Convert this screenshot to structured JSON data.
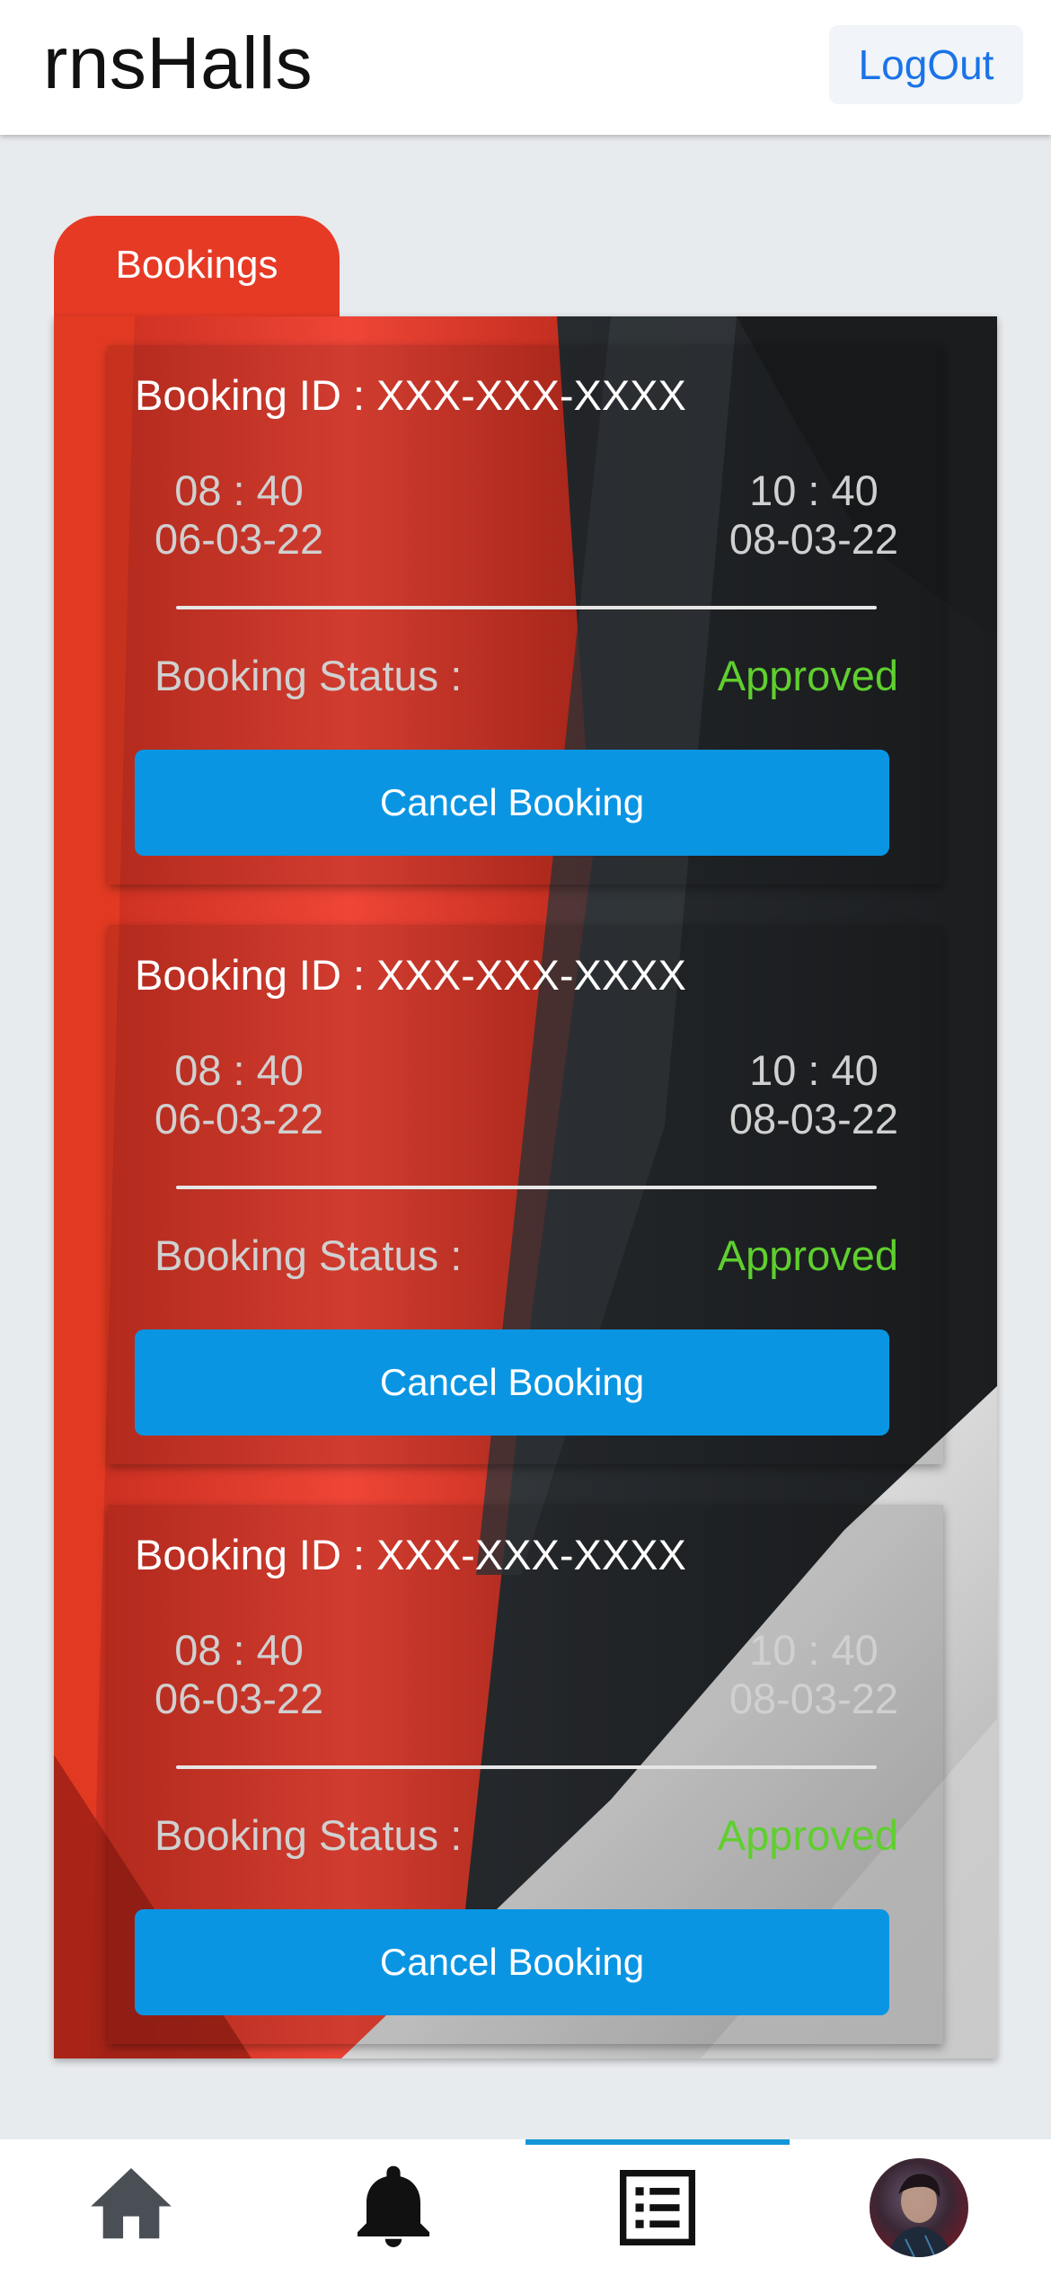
{
  "header": {
    "title": "rnsHalls",
    "logout_label": "LogOut"
  },
  "tab": {
    "label": "Bookings"
  },
  "bookings": [
    {
      "id_text": "Booking ID : XXX-XXX-XXXX",
      "start_time": "08 : 40",
      "start_date": "06-03-22",
      "end_time": "10 : 40",
      "end_date": "08-03-22",
      "status_label": "Booking Status :",
      "status": "Approved",
      "cancel_label": "Cancel Booking"
    },
    {
      "id_text": "Booking ID : XXX-XXX-XXXX",
      "start_time": "08 : 40",
      "start_date": "06-03-22",
      "end_time": "10 : 40",
      "end_date": "08-03-22",
      "status_label": "Booking Status :",
      "status": "Approved",
      "cancel_label": "Cancel Booking"
    },
    {
      "id_text": "Booking ID : XXX-XXX-XXXX",
      "start_time": "08 : 40",
      "start_date": "06-03-22",
      "end_time": "10 : 40",
      "end_date": "08-03-22",
      "status_label": "Booking Status :",
      "status": "Approved",
      "cancel_label": "Cancel Booking"
    }
  ],
  "colors": {
    "accent_red": "#e63a25",
    "button_blue": "#0a95e3",
    "status_green": "#5fcf2e",
    "logout_blue": "#1a73e8",
    "active_tab_indicator": "#1496d8"
  },
  "bottom_nav": {
    "items": [
      {
        "icon": "home-icon",
        "active": false
      },
      {
        "icon": "bell-icon",
        "active": false
      },
      {
        "icon": "list-icon",
        "active": true
      },
      {
        "icon": "avatar",
        "active": false
      }
    ]
  }
}
